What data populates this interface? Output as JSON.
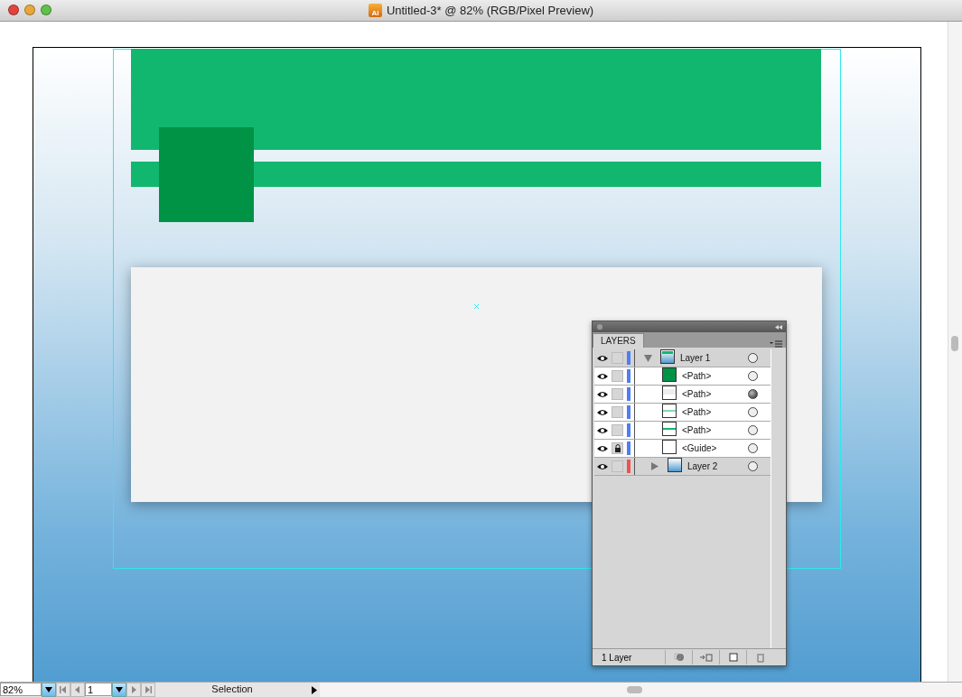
{
  "window": {
    "title": "Untitled-3* @ 82% (RGB/Pixel Preview)",
    "app_icon": "Ai"
  },
  "layers_panel": {
    "tab": "LAYERS",
    "footer_count": "1 Layer",
    "layers": [
      {
        "name": "Layer 1",
        "color": "#4f7df5",
        "visible": true,
        "locked": false,
        "expanded": true,
        "targeted": false,
        "children": [
          {
            "name": "<Path>",
            "kind": "square",
            "visible": true,
            "locked": false,
            "targeted": false
          },
          {
            "name": "<Path>",
            "kind": "panel",
            "visible": true,
            "locked": false,
            "targeted": true
          },
          {
            "name": "<Path>",
            "kind": "stripe",
            "visible": true,
            "locked": false,
            "targeted": false
          },
          {
            "name": "<Path>",
            "kind": "bar",
            "visible": true,
            "locked": false,
            "targeted": false
          },
          {
            "name": "<Guide>",
            "kind": "guide",
            "visible": true,
            "locked": true,
            "targeted": false
          }
        ]
      },
      {
        "name": "Layer 2",
        "color": "#f05050",
        "visible": true,
        "locked": false,
        "expanded": false,
        "targeted": false
      }
    ]
  },
  "status_bar": {
    "zoom": "82%",
    "page": "1",
    "tool": "Selection"
  }
}
